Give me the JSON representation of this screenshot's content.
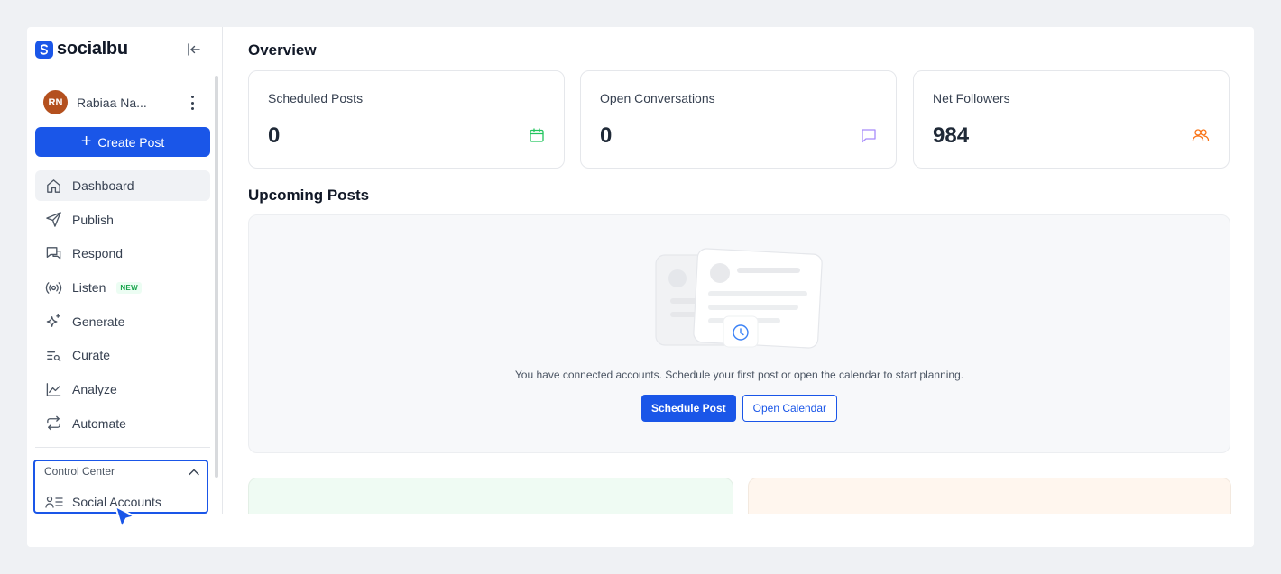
{
  "brand": {
    "name": "socialbu"
  },
  "user": {
    "initials": "RN",
    "name": "Rabiaa Na..."
  },
  "sidebar": {
    "create_post_label": "Create Post",
    "items": [
      {
        "label": "Dashboard",
        "icon": "home-icon",
        "active": true
      },
      {
        "label": "Publish",
        "icon": "send-icon"
      },
      {
        "label": "Respond",
        "icon": "chat-icon"
      },
      {
        "label": "Listen",
        "icon": "broadcast-icon",
        "badge": "NEW"
      },
      {
        "label": "Generate",
        "icon": "sparkle-icon"
      },
      {
        "label": "Curate",
        "icon": "list-search-icon"
      },
      {
        "label": "Analyze",
        "icon": "chart-line-icon"
      },
      {
        "label": "Automate",
        "icon": "repeat-icon"
      }
    ],
    "control_center": {
      "label": "Control Center",
      "items": [
        {
          "label": "Social Accounts",
          "icon": "user-list-icon"
        }
      ]
    }
  },
  "overview": {
    "title": "Overview",
    "cards": [
      {
        "label": "Scheduled Posts",
        "value": "0",
        "icon": "calendar-icon",
        "color": "#22c55e"
      },
      {
        "label": "Open Conversations",
        "value": "0",
        "icon": "message-icon",
        "color": "#a78bfa"
      },
      {
        "label": "Net Followers",
        "value": "984",
        "icon": "users-icon",
        "color": "#f97316"
      }
    ]
  },
  "upcoming": {
    "title": "Upcoming Posts",
    "empty_text": "You have connected accounts. Schedule your first post or open the calendar to start planning.",
    "schedule_label": "Schedule Post",
    "calendar_label": "Open Calendar"
  },
  "colors": {
    "accent": "#1a56e8"
  }
}
